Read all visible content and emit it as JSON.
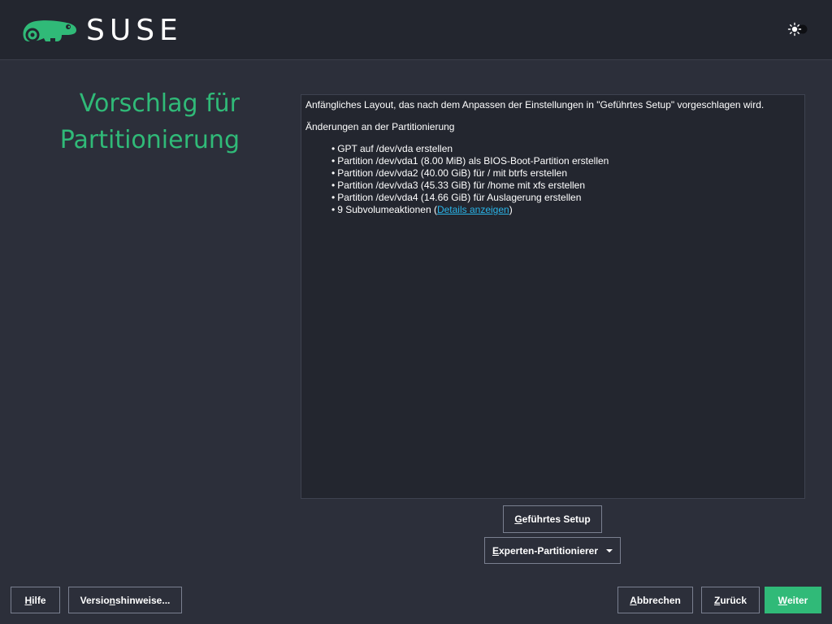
{
  "header": {
    "logo_text": "SUSE",
    "theme_toggle_icon": "sun-icon"
  },
  "title": {
    "line1": "Vorschlag für",
    "line2": "Partitionierung"
  },
  "summary": {
    "intro": "Anfängliches Layout, das nach dem Anpassen der Einstellungen in \"Geführtes Setup\" vorgeschlagen wird.",
    "heading": "Änderungen an der Partitionierung",
    "items": [
      "GPT auf /dev/vda erstellen",
      "Partition /dev/vda1 (8.00 MiB) als BIOS-Boot-Partition erstellen",
      "Partition /dev/vda2 (40.00 GiB) für / mit btrfs erstellen",
      "Partition /dev/vda3 (45.33 GiB) für /home mit xfs erstellen",
      "Partition /dev/vda4 (14.66 GiB) für Auslagerung erstellen"
    ],
    "subvolume_prefix": "9 Subvolumeaktionen (",
    "subvolume_link": "Details anzeigen",
    "subvolume_suffix": ")"
  },
  "buttons": {
    "guided_setup": {
      "mnemonic": "G",
      "rest": "eführtes Setup"
    },
    "expert_partitioner": {
      "mnemonic": "E",
      "rest": "xperten-Partitionierer"
    },
    "help": {
      "mnemonic": "H",
      "rest": "ilfe"
    },
    "release_notes": {
      "before": "Versio",
      "mnemonic": "n",
      "after": "shinweise..."
    },
    "abort": {
      "mnemonic": "A",
      "rest": "bbrechen"
    },
    "back": {
      "mnemonic": "Z",
      "rest": "urück"
    },
    "next": {
      "mnemonic": "W",
      "rest": "eiter"
    }
  },
  "colors": {
    "accent": "#30ba78",
    "background": "#2c2f3a",
    "header": "#23262f",
    "link": "#2ab4e8"
  }
}
